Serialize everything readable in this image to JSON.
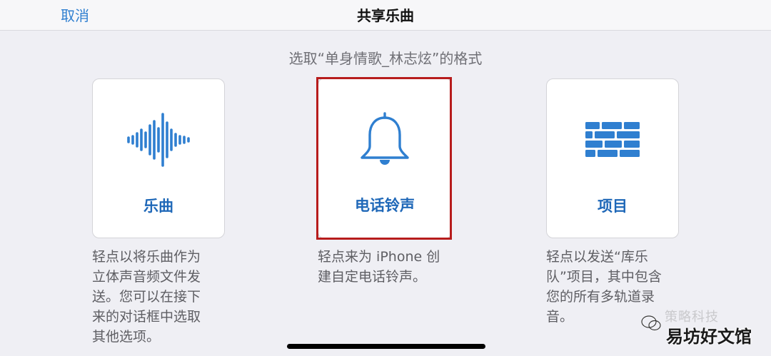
{
  "navbar": {
    "cancel_label": "取消",
    "title": "共享乐曲"
  },
  "subtitle": "选取“单身情歌_林志炫”的格式",
  "options": [
    {
      "label": "乐曲",
      "icon": "waveform-icon",
      "description_lines": [
        "轻点以将乐曲作为",
        "立体声音频文件发",
        "送。您可以在接下",
        "来的对话框中选取",
        "其他选项。"
      ]
    },
    {
      "label": "电话铃声",
      "icon": "bell-icon",
      "description_lines": [
        "轻点来为 iPhone 创",
        "建自定电话铃声。"
      ]
    },
    {
      "label": "项目",
      "icon": "bricks-icon",
      "description_lines": [
        "轻点以发送“库乐",
        "队”项目，其中包含",
        "您的所有多轨道录",
        "音。"
      ]
    }
  ],
  "watermark": {
    "top_text": "策略科技",
    "bottom_text": "易坊好文馆"
  },
  "colors": {
    "accent": "#2f7fd0",
    "label_blue": "#1f68b8",
    "highlight_red": "#b71c1c",
    "background": "#efeff4"
  }
}
